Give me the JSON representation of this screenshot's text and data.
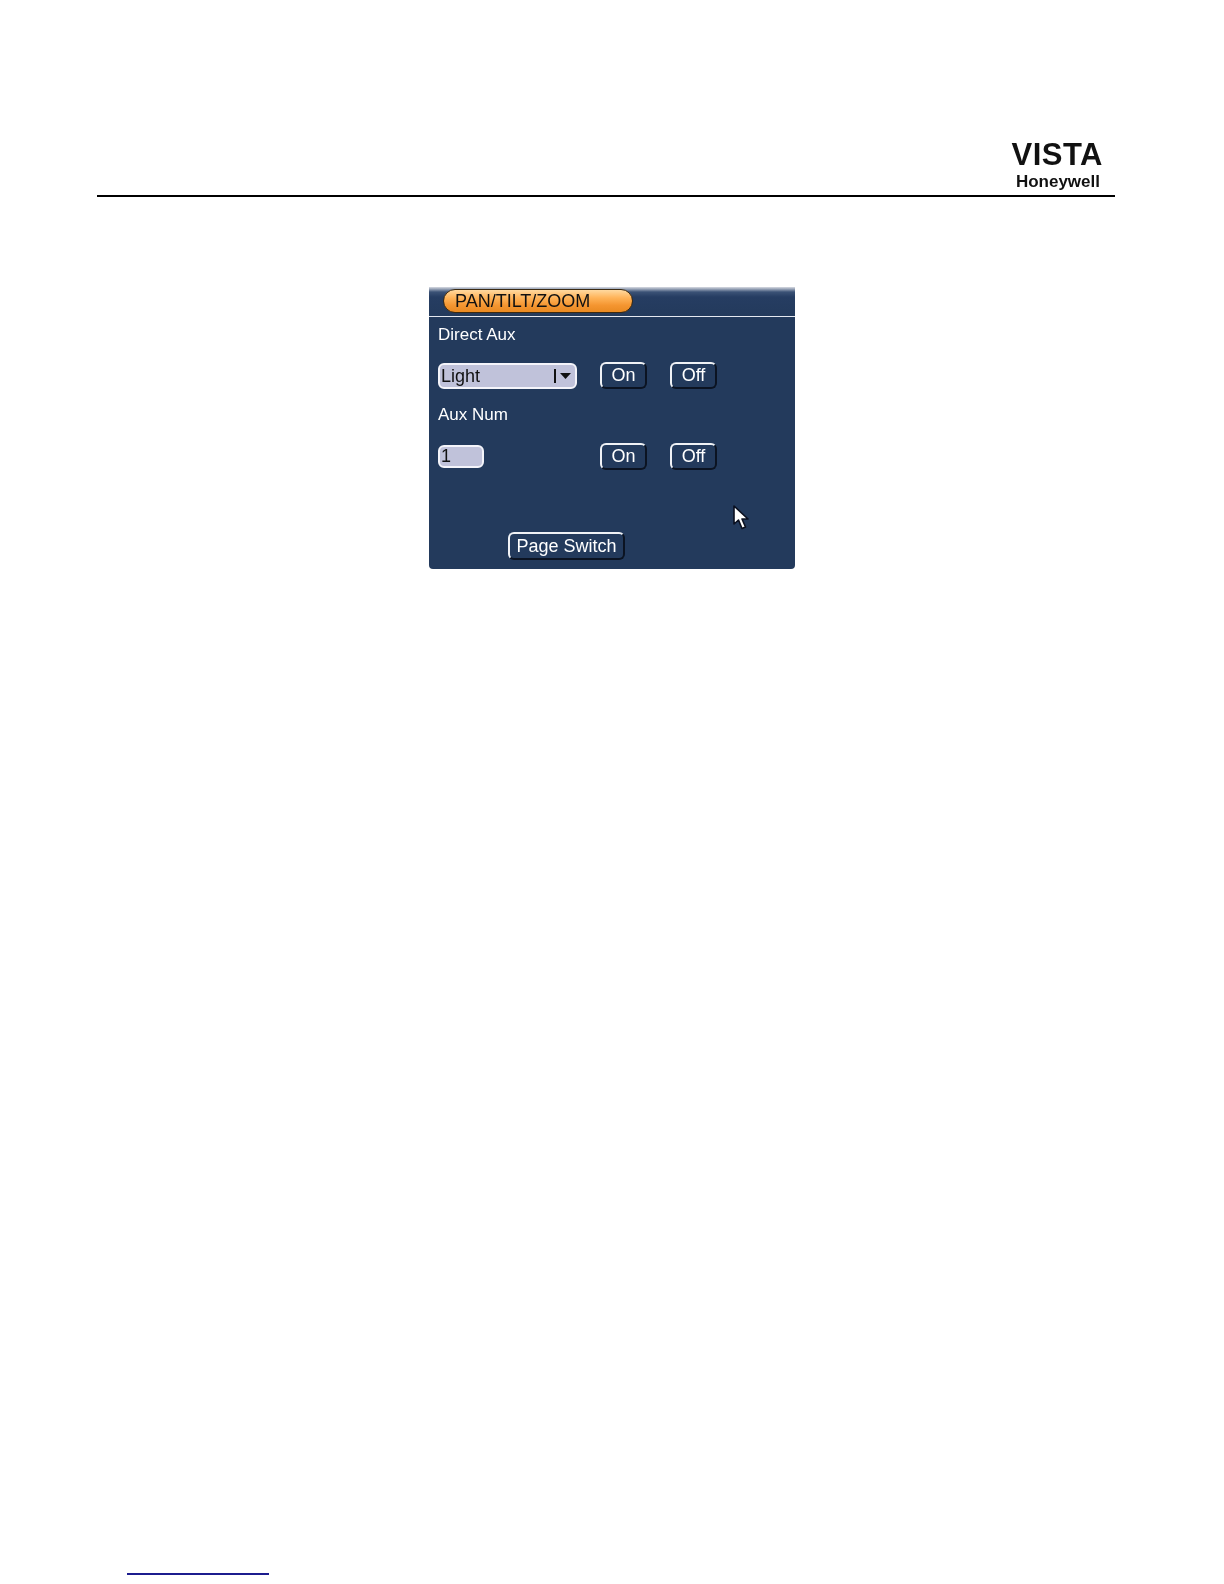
{
  "header": {
    "logo": {
      "brand": "VISTA",
      "maker": "Honeywell"
    }
  },
  "panel": {
    "tabs": [
      {
        "label": "PAN/TILT/ZOOM",
        "selected": true
      }
    ],
    "sections": [
      {
        "label": "Direct Aux",
        "kind": "dropdown",
        "value": "Light",
        "buttons": [
          "On",
          "Off"
        ]
      },
      {
        "label": "Aux Num",
        "kind": "number",
        "value": "1",
        "buttons": [
          "On",
          "Off"
        ]
      }
    ],
    "footer_button": "Page Switch"
  }
}
